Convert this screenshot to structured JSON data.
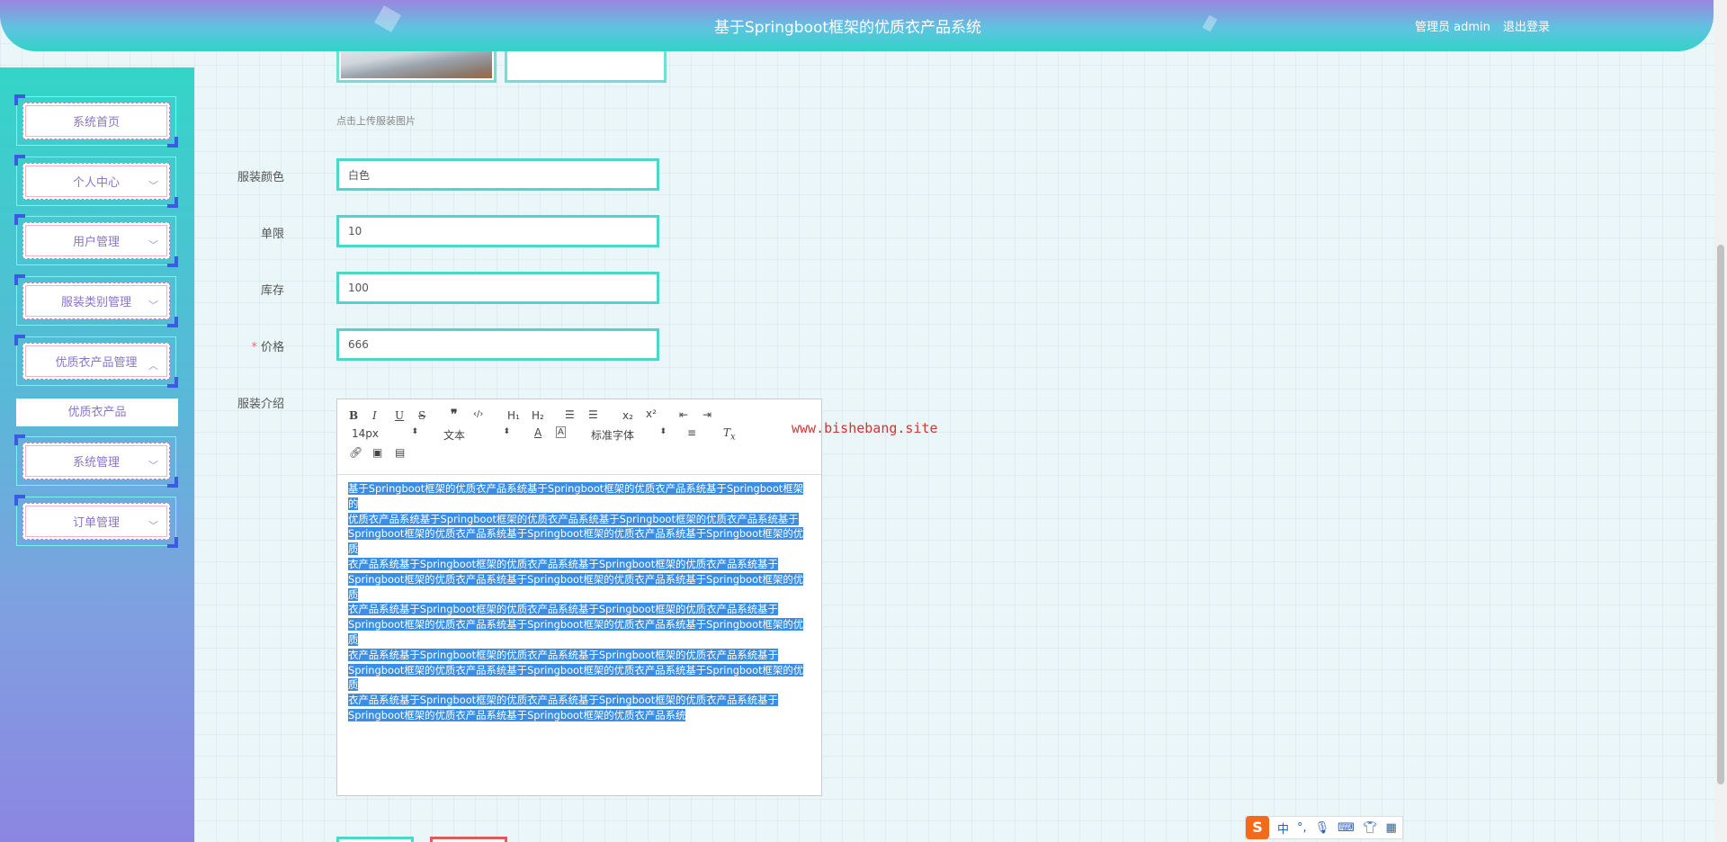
{
  "header": {
    "title": "基于Springboot框架的优质衣产品系统",
    "user_label": "管理员 admin",
    "logout_label": "退出登录"
  },
  "sidebar": {
    "items": [
      {
        "label": "系统首页"
      },
      {
        "label": "个人中心"
      },
      {
        "label": "用户管理"
      },
      {
        "label": "服装类别管理"
      },
      {
        "label": "优质衣产品管理"
      },
      {
        "label": "系统管理"
      },
      {
        "label": "订单管理"
      }
    ],
    "submenu_label": "优质衣产品"
  },
  "form": {
    "upload_hint": "点击上传服装图片",
    "color_label": "服装颜色",
    "color_value": "白色",
    "limit_label": "单限",
    "limit_value": "10",
    "stock_label": "库存",
    "stock_value": "100",
    "price_required": "*",
    "price_label": "价格",
    "price_value": "666",
    "intro_label": "服装介绍"
  },
  "editor": {
    "font_size": "14px",
    "paragraph": "文本",
    "font_family": "标准字体",
    "lines": [
      "基于Springboot框架的优质衣产品系统基于Springboot框架的优质衣产品系统基于Springboot框架的",
      "优质衣产品系统基于Springboot框架的优质衣产品系统基于Springboot框架的优质衣产品系统基于",
      "Springboot框架的优质衣产品系统基于Springboot框架的优质衣产品系统基于Springboot框架的优质",
      "衣产品系统基于Springboot框架的优质衣产品系统基于Springboot框架的优质衣产品系统基于",
      "Springboot框架的优质衣产品系统基于Springboot框架的优质衣产品系统基于Springboot框架的优质",
      "衣产品系统基于Springboot框架的优质衣产品系统基于Springboot框架的优质衣产品系统基于",
      "Springboot框架的优质衣产品系统基于Springboot框架的优质衣产品系统基于Springboot框架的优质",
      "衣产品系统基于Springboot框架的优质衣产品系统基于Springboot框架的优质衣产品系统基于",
      "Springboot框架的优质衣产品系统基于Springboot框架的优质衣产品系统基于Springboot框架的优质",
      "衣产品系统基于Springboot框架的优质衣产品系统基于Springboot框架的优质衣产品系统基于",
      "Springboot框架的优质衣产品系统基于Springboot框架的优质衣产品系统"
    ]
  },
  "watermark": "www.bishebang.site",
  "ime": {
    "logo": "S",
    "mode": "中"
  }
}
